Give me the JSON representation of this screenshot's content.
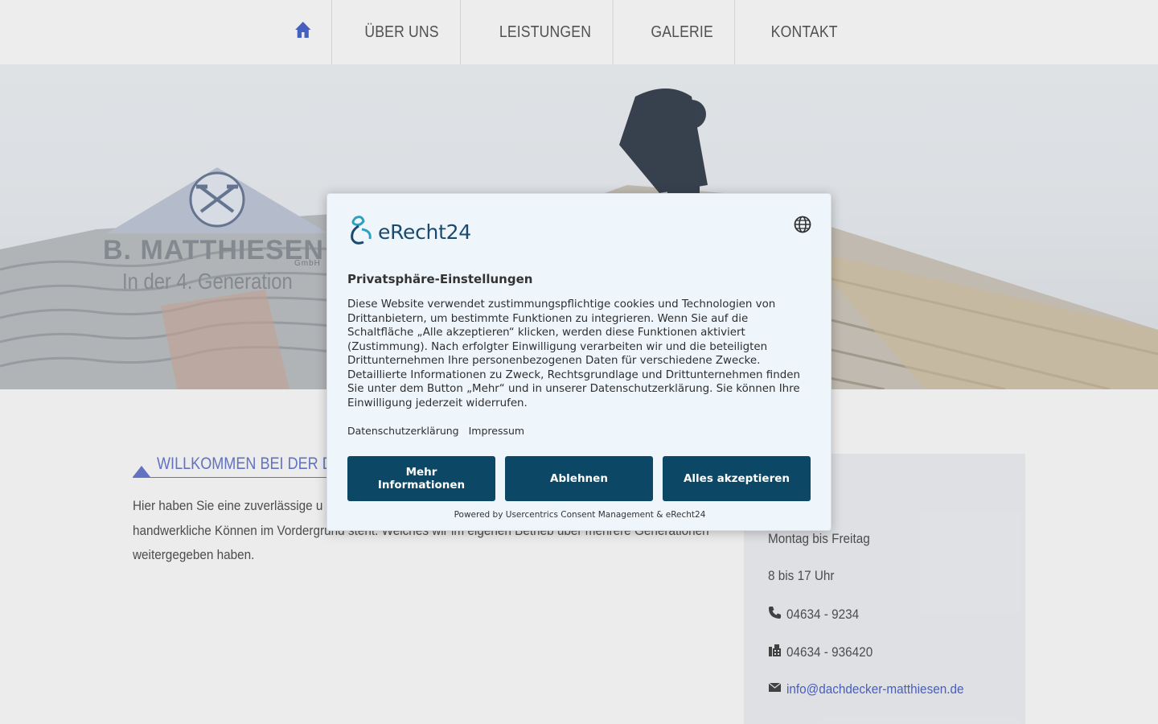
{
  "nav": {
    "home_icon": "home-icon",
    "items": [
      {
        "label": "ÜBER UNS"
      },
      {
        "label": "LEISTUNGEN"
      },
      {
        "label": "GALERIE"
      },
      {
        "label": "KONTAKT"
      }
    ]
  },
  "hero": {
    "logo_name": "B. MATTHIESEN",
    "logo_suffix": "GmbH",
    "tagline": "In der 4. Generation"
  },
  "welcome": {
    "title": "WILLKOMMEN BEI DER D",
    "text": "Hier haben Sie eine zuverlässige u Umgebung gefunden. Wo die Liebe zum Handwerk und das handwerkliche Können im Vordergrund steht. Welches wir im eigenen Betrieb über mehrere Generationen weitergegeben haben."
  },
  "sidebar": {
    "days": "Montag bis Freitag",
    "hours": "8 bis 17 Uhr",
    "phone": "04634 - 9234",
    "fax": "04634 - 936420",
    "email": "info@dachdecker-matthiesen.de"
  },
  "consent": {
    "brand": "eRecht24",
    "title": "Privatsphäre-Einstellungen",
    "body": "Diese Website verwendet zustimmungspflichtige cookies und Technologien von Drittanbietern, um bestimmte Funktionen zu integrieren. Wenn Sie auf die Schaltfläche „Alle akzeptieren“ klicken, werden diese Funktionen aktiviert (Zustimmung). Nach erfolgter Einwilligung verarbeiten wir und die beteiligten Drittunternehmen Ihre personenbezogenen Daten für verschiedene Zwecke. Detaillierte Informationen zu Zweck, Rechtsgrundlage und Drittunternehmen finden Sie unter dem Button „Mehr“ und in unserer Datenschutzerklärung. Sie können Ihre Einwilligung jederzeit widerrufen.",
    "link_privacy": "Datenschutzerklärung",
    "link_imprint": "Impressum",
    "btn_more": "Mehr Informationen",
    "btn_deny": "Ablehnen",
    "btn_accept": "Alles akzeptieren",
    "powered": "Powered by Usercentrics Consent Management & eRecht24"
  },
  "colors": {
    "accent": "#6677c9",
    "button": "#0d4766",
    "modal_bg": "#eef6fc"
  }
}
